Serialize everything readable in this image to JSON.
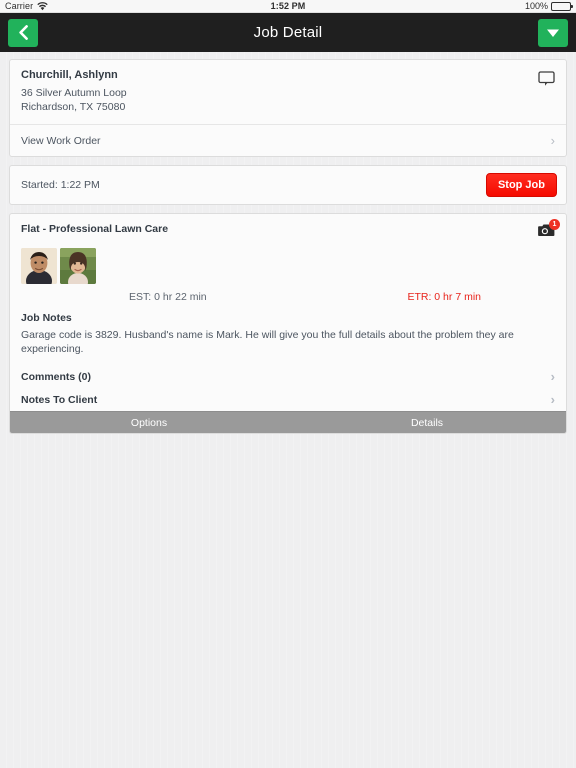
{
  "status_bar": {
    "carrier": "Carrier",
    "wifi_icon": "wifi-icon",
    "time": "1:52 PM",
    "battery_percent": "100%",
    "battery_icon": "battery-icon"
  },
  "nav_bar": {
    "title": "Job Detail",
    "back_icon": "chevron-left-icon",
    "menu_icon": "triangle-down-icon"
  },
  "customer_card": {
    "name": "Churchill, Ashlynn",
    "address_line1": "36 Silver Autumn Loop",
    "address_line2": "Richardson, TX 75080",
    "message_icon": "speech-bubble-icon",
    "work_order_label": "View Work Order",
    "chevron_icon": "chevron-right-icon"
  },
  "timer_card": {
    "started_label": "Started: 1:22 PM",
    "stop_button": "Stop Job"
  },
  "job_card": {
    "title": "Flat - Professional Lawn Care",
    "camera_icon": "camera-icon",
    "camera_badge_count": "1",
    "avatars": [
      {
        "name": "avatar-technician-1"
      },
      {
        "name": "avatar-technician-2"
      }
    ],
    "est_label": "EST: 0 hr 22 min",
    "etr_label": "ETR: 0 hr 7 min",
    "notes_title": "Job Notes",
    "notes_body": "Garage code is 3829. Husband's name is Mark. He will give you the full details about the problem they are experiencing.",
    "comments_label": "Comments (0)",
    "notes_to_client_label": "Notes To Client",
    "chevron_icon": "chevron-right-icon"
  },
  "tab_bar": {
    "tabs": [
      {
        "label": "Options"
      },
      {
        "label": "Details"
      }
    ]
  },
  "colors": {
    "nav_background": "#1f1f1f",
    "accent_green": "#21b25b",
    "stop_red": "#f50b00",
    "etr_red": "#e8241c",
    "tab_gray": "#9a9a9a"
  }
}
